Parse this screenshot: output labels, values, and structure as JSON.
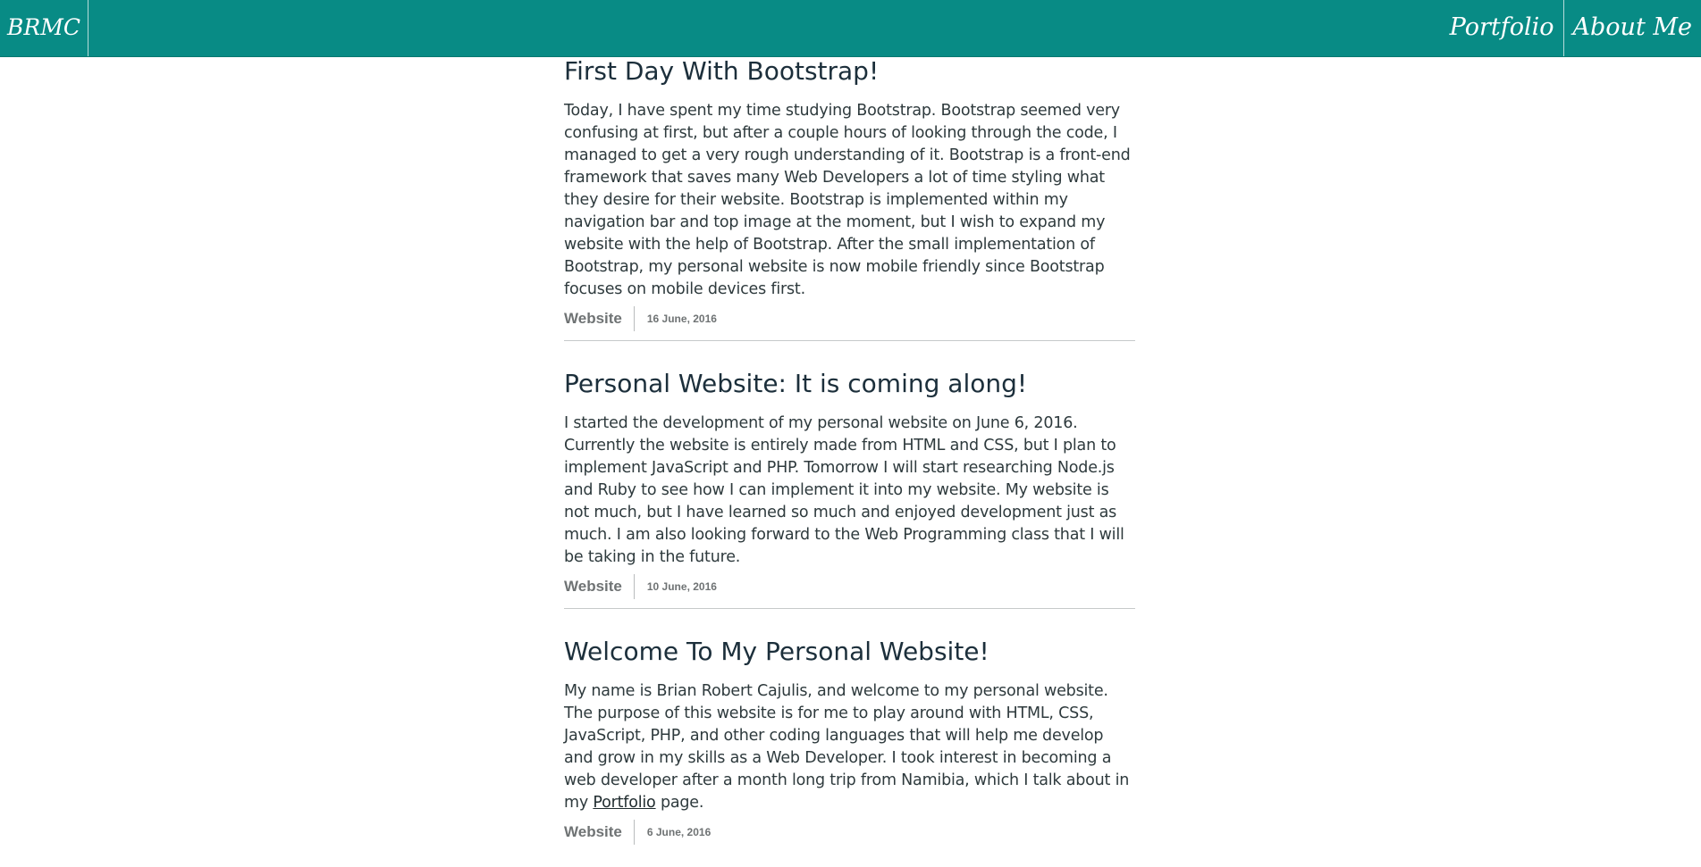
{
  "navbar": {
    "brand": "BRMC",
    "links": [
      {
        "label": "Portfolio"
      },
      {
        "label": "About Me"
      }
    ],
    "background": "#088b85"
  },
  "posts": [
    {
      "title": "First Day With Bootstrap!",
      "body": "Today, I have spent my time studying Bootstrap. Bootstrap seemed very confusing at first, but after a couple hours of looking through the code, I managed to get a very rough understanding of it. Bootstrap is a front-end framework that saves many Web Developers a lot of time styling what they desire for their website. Bootstrap is implemented within my navigation bar and top image at the moment, but I wish to expand my website with the help of Bootstrap. After the small implementation of Bootstrap, my personal website is now mobile friendly since Bootstrap focuses on mobile devices first.",
      "category": "Website",
      "date": "16 June, 2016"
    },
    {
      "title": "Personal Website: It is coming along!",
      "body": "I started the development of my personal website on June 6, 2016. Currently the website is entirely made from HTML and CSS, but I plan to implement JavaScript and PHP. Tomorrow I will start researching Node.js and Ruby to see how I can implement it into my website. My website is not much, but I have learned so much and enjoyed development just as much. I am also looking forward to the Web Programming class that I will be taking in the future.",
      "category": "Website",
      "date": "10 June, 2016"
    },
    {
      "title": "Welcome To My Personal Website!",
      "body_before_link": "My name is Brian Robert Cajulis, and welcome to my personal website. The purpose of this website is for me to play around with HTML, CSS, JavaScript, PHP, and other coding languages that will help me develop and grow in my skills as a Web Developer. I took interest in becoming a web developer after a month long trip from Namibia, which I talk about in my ",
      "link_text": "Portfolio",
      "body_after_link": " page.",
      "category": "Website",
      "date": "6 June, 2016"
    }
  ]
}
